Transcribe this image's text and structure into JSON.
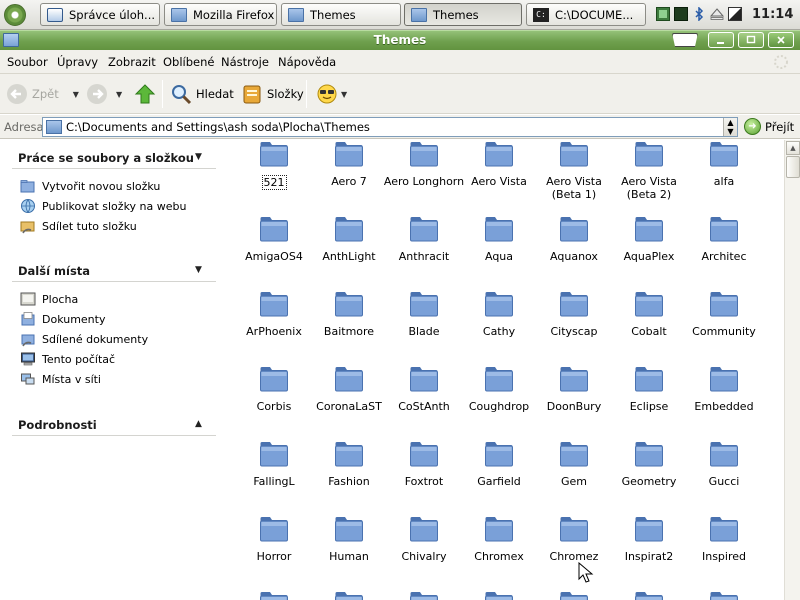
{
  "taskbar": {
    "tasks": [
      {
        "label": "Správce úloh...",
        "icon": "task-manager-icon"
      },
      {
        "label": "Mozilla Firefox",
        "icon": "folder-icon"
      },
      {
        "label": "Themes",
        "icon": "folder-icon"
      },
      {
        "label": "Themes",
        "icon": "folder-icon"
      },
      {
        "label": "C:\\DOCUME...",
        "icon": "command-prompt-icon"
      }
    ],
    "active_task": 3,
    "clock": "11:14"
  },
  "window": {
    "title": "Themes",
    "controls": [
      "minimize",
      "maximize",
      "close"
    ]
  },
  "menu": {
    "items": [
      "Soubor",
      "Úpravy",
      "Zobrazit",
      "Oblíbené",
      "Nástroje",
      "Nápověda"
    ]
  },
  "toolbar": {
    "back_label": "Zpět",
    "search_label": "Hledat",
    "folders_label": "Složky"
  },
  "address": {
    "label": "Adresa",
    "path": "C:\\Documents and Settings\\ash soda\\Plocha\\Themes",
    "go_label": "Přejít"
  },
  "taskpane": {
    "file_tasks": {
      "title": "Práce se soubory a složkou",
      "items": [
        "Vytvořit novou složku",
        "Publikovat složky na webu",
        "Sdílet tuto složku"
      ]
    },
    "other_places": {
      "title": "Další místa",
      "items": [
        "Plocha",
        "Dokumenty",
        "Sdílené dokumenty",
        "Tento počítač",
        "Místa v síti"
      ]
    },
    "details": {
      "title": "Podrobnosti"
    }
  },
  "folders": [
    "521",
    "Aero 7",
    "Aero Longhorn",
    "Aero Vista",
    "Aero Vista\n(Beta 1)",
    "Aero Vista\n(Beta 2)",
    "alfa",
    "AmigaOS4",
    "AnthLight",
    "Anthracit",
    "Aqua",
    "Aquanox",
    "AquaPlex",
    "Architec",
    "ArPhoenix",
    "Baitmore",
    "Blade",
    "Cathy",
    "Cityscap",
    "Cobalt",
    "Community",
    "Corbis",
    "CoronaLaST",
    "CoStAnth",
    "Coughdrop",
    "DoonBury",
    "Eclipse",
    "Embedded",
    "FallingL",
    "Fashion",
    "Foxtrot",
    "Garfield",
    "Gem",
    "Geometry",
    "Gucci",
    "Horror",
    "Human",
    "Chivalry",
    "Chromex",
    "Chromez",
    "Inspirat2",
    "Inspired",
    "",
    "",
    "",
    "",
    "",
    "",
    ""
  ],
  "selected_folder": 0,
  "colors": {
    "titlebar": "#6fa04e",
    "folder_fill": "#7aa0d8",
    "folder_dark": "#4a72b0",
    "address_border": "#7f9db9"
  }
}
